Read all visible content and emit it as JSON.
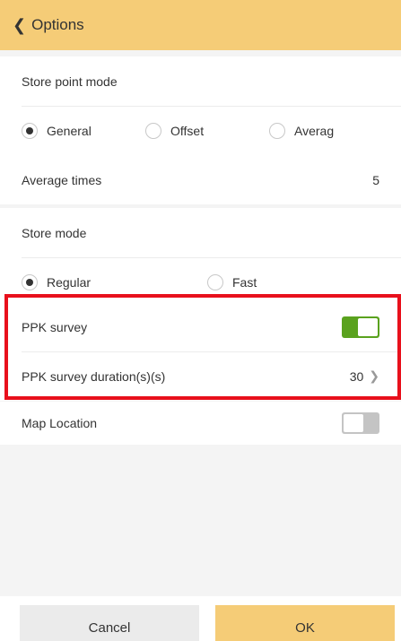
{
  "header": {
    "back_label": "Options"
  },
  "store_point": {
    "title": "Store point mode",
    "options": [
      "General",
      "Offset",
      "Averag"
    ],
    "selected": "General"
  },
  "average_times": {
    "label": "Average times",
    "value": "5"
  },
  "store_mode": {
    "title": "Store mode",
    "options": [
      "Regular",
      "Fast"
    ],
    "selected": "Regular"
  },
  "ppk": {
    "survey_label": "PPK survey",
    "survey_enabled": true,
    "duration_label": "PPK survey duration(s)(s)",
    "duration_value": "30"
  },
  "map_location": {
    "label": "Map Location",
    "enabled": false
  },
  "footer": {
    "cancel_label": "Cancel",
    "ok_label": "OK"
  },
  "colors": {
    "header_bg": "#f5cc77",
    "toggle_on": "#5aa21e",
    "toggle_off": "#c4c4c4",
    "highlight": "#e8101c"
  }
}
